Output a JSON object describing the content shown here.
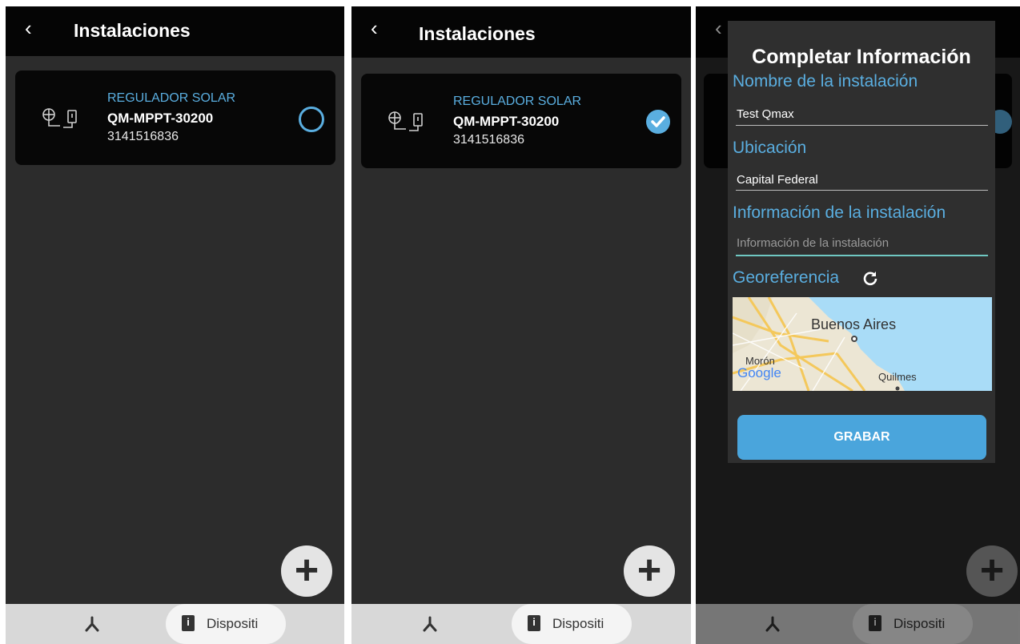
{
  "screens": [
    {
      "header": {
        "back_icon": "chevron-left-icon",
        "title": "Instalaciones"
      },
      "device": {
        "category": "REGULADOR SOLAR",
        "model": "QM-MPPT-30200",
        "serial": "3141516836",
        "selected": false
      },
      "fab": {
        "icon": "plus-icon"
      },
      "bottom_nav": {
        "devices_label": "Dispositi"
      }
    },
    {
      "header": {
        "back_icon": "chevron-left-icon",
        "title": "Instalaciones"
      },
      "device": {
        "category": "REGULADOR SOLAR",
        "model": "QM-MPPT-30200",
        "serial": "3141516836",
        "selected": true
      },
      "fab": {
        "icon": "plus-icon"
      },
      "bottom_nav": {
        "devices_label": "Dispositi"
      }
    },
    {
      "header": {
        "back_icon": "chevron-left-icon"
      },
      "dialog": {
        "title": "Completar Información",
        "name_label": "Nombre de la instalación",
        "name_value": "Test Qmax",
        "location_label": "Ubicación",
        "location_value": "Capital Federal",
        "info_label": "Información de la instalación",
        "info_placeholder": "Información de la instalación",
        "geo_label": "Georeferencia",
        "map": {
          "city_main": "Buenos Aires",
          "city_west": "Morón",
          "city_south": "Quilmes",
          "brand": "Google"
        },
        "save_label": "GRABAR"
      },
      "fab": {
        "icon": "plus-icon"
      },
      "bottom_nav": {
        "devices_label": "Dispositi"
      }
    }
  ],
  "colors": {
    "accent": "#5aaee0",
    "background": "#2c2c2c",
    "topbar": "#050505",
    "button": "#4aa5dc"
  }
}
